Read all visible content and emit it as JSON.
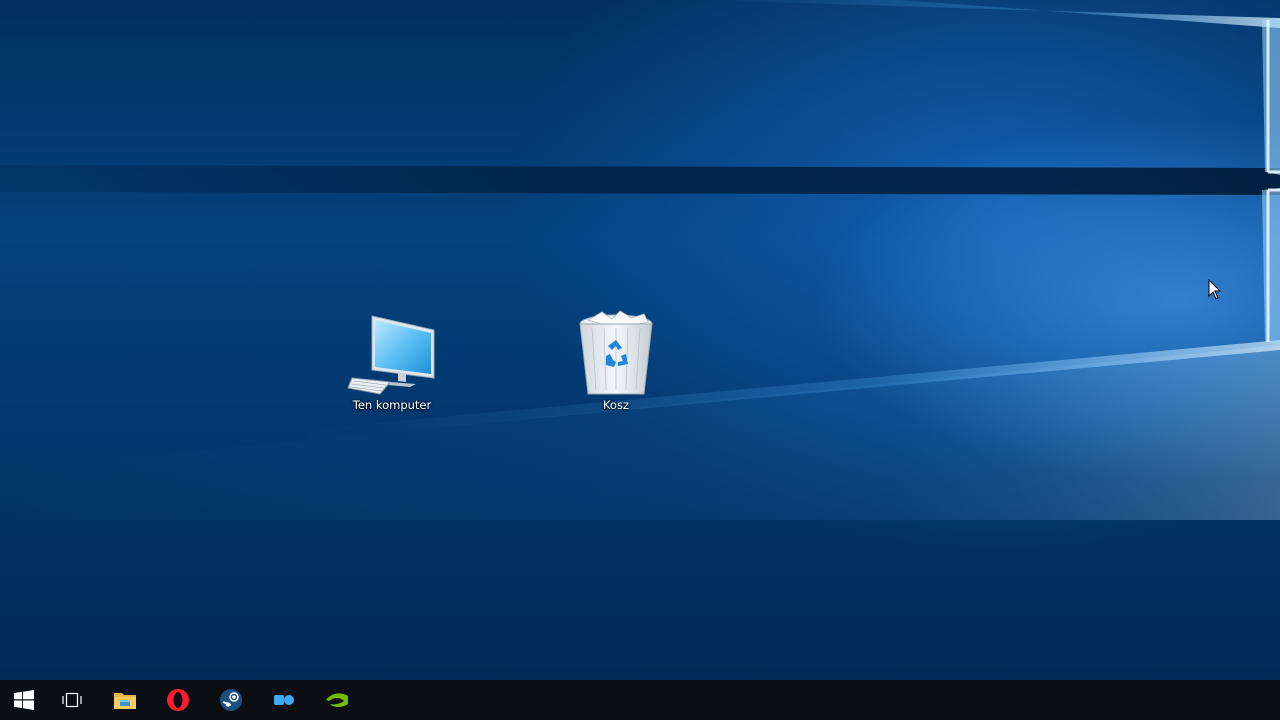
{
  "desktop": {
    "icons": [
      {
        "label": "Ten komputer",
        "icon": "computer-icon"
      },
      {
        "label": "Kosz",
        "icon": "recycle-bin-icon"
      }
    ]
  },
  "taskbar": {
    "items": [
      {
        "icon": "windows-logo-icon"
      },
      {
        "icon": "task-view-icon"
      },
      {
        "icon": "file-explorer-icon"
      },
      {
        "icon": "opera-icon"
      },
      {
        "icon": "steam-icon"
      },
      {
        "icon": "app-icon"
      },
      {
        "icon": "nvidia-icon"
      }
    ]
  },
  "colors": {
    "wallpaper": "#04417e",
    "taskbar": "#0b0f14",
    "accent": "#4fb4ff"
  }
}
